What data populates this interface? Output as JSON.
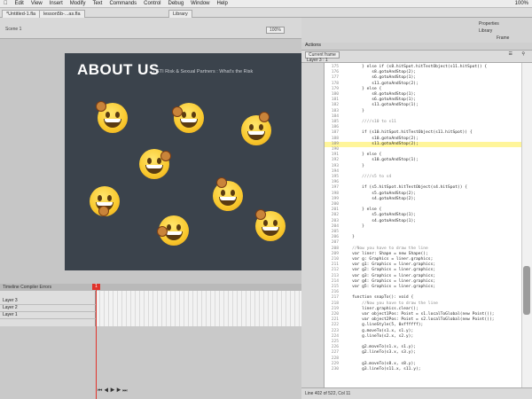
{
  "menubar": {
    "items": [
      "Edit",
      "View",
      "Insert",
      "Modify",
      "Text",
      "Commands",
      "Control",
      "Debug",
      "Window",
      "Help"
    ],
    "right": "100%"
  },
  "tabs": [
    "*Untitled-1.fla",
    "lesson5b-...as.fla",
    "Library"
  ],
  "stage": {
    "scene": "Scene 1",
    "zoom": "100%"
  },
  "canvas": {
    "title": "ABOUT US",
    "subtitle": "/ STI Risk & Sexual Partners : What's the Risk"
  },
  "timeline": {
    "header": "Timeline   Compiler Errors",
    "layers": [
      "Layer 3",
      "Layer 2",
      "Layer 1"
    ],
    "current_frame": "1"
  },
  "actions": {
    "title": "Actions",
    "tab": "Current frame",
    "layer": "Layer 3 : 1",
    "status": "Line 402 of 522, Col 11",
    "right_panel_labels": [
      "Properties",
      "Library",
      "Frame"
    ]
  },
  "code_lines": [
    {
      "n": "175",
      "t": "        } else if (s8.hitSpot.hitTestObject(s11.hitSpot)) {",
      "c": ""
    },
    {
      "n": "176",
      "t": "            s8.gotoAndStop(2);",
      "c": ""
    },
    {
      "n": "177",
      "t": "            s6.gotoAndStop(1);",
      "c": ""
    },
    {
      "n": "178",
      "t": "            s11.gotoAndStop(2);",
      "c": ""
    },
    {
      "n": "179",
      "t": "        } else {",
      "c": ""
    },
    {
      "n": "180",
      "t": "            s8.gotoAndStop(1);",
      "c": ""
    },
    {
      "n": "181",
      "t": "            s6.gotoAndStop(1);",
      "c": ""
    },
    {
      "n": "182",
      "t": "            s11.gotoAndStop(1);",
      "c": ""
    },
    {
      "n": "183",
      "t": "        }",
      "c": ""
    },
    {
      "n": "184",
      "t": "",
      "c": ""
    },
    {
      "n": "185",
      "t": "        ////s10 to s11",
      "c": "cm"
    },
    {
      "n": "186",
      "t": "",
      "c": ""
    },
    {
      "n": "187",
      "t": "        if (s10.hitSpot.hitTestObject(s11.hitSpot)) {",
      "c": ""
    },
    {
      "n": "188",
      "t": "            s10.gotoAndStop(2);",
      "c": ""
    },
    {
      "n": "189",
      "t": "            s11.gotoAndStop(2);",
      "c": "hl"
    },
    {
      "n": "190",
      "t": "",
      "c": ""
    },
    {
      "n": "191",
      "t": "        } else {",
      "c": ""
    },
    {
      "n": "192",
      "t": "            s10.gotoAndStop(1);",
      "c": ""
    },
    {
      "n": "193",
      "t": "        }",
      "c": ""
    },
    {
      "n": "194",
      "t": "",
      "c": ""
    },
    {
      "n": "195",
      "t": "        ////s5 to s4",
      "c": "cm"
    },
    {
      "n": "196",
      "t": "",
      "c": ""
    },
    {
      "n": "197",
      "t": "        if (s5.hitSpot.hitTestObject(s4.hitSpot)) {",
      "c": ""
    },
    {
      "n": "198",
      "t": "            s5.gotoAndStop(2);",
      "c": ""
    },
    {
      "n": "199",
      "t": "            s4.gotoAndStop(2);",
      "c": ""
    },
    {
      "n": "200",
      "t": "",
      "c": ""
    },
    {
      "n": "201",
      "t": "        } else {",
      "c": ""
    },
    {
      "n": "202",
      "t": "            s5.gotoAndStop(1);",
      "c": ""
    },
    {
      "n": "203",
      "t": "            s4.gotoAndStop(1);",
      "c": ""
    },
    {
      "n": "204",
      "t": "        }",
      "c": ""
    },
    {
      "n": "205",
      "t": "",
      "c": ""
    },
    {
      "n": "206",
      "t": "    }",
      "c": ""
    },
    {
      "n": "207",
      "t": "",
      "c": ""
    },
    {
      "n": "208",
      "t": "    //Now you have to draw the line",
      "c": "cm"
    },
    {
      "n": "209",
      "t": "    var liner: Shape = new Shape();",
      "c": ""
    },
    {
      "n": "210",
      "t": "    var g: Graphics = liner.graphics;",
      "c": ""
    },
    {
      "n": "211",
      "t": "    var g1: Graphics = liner.graphics;",
      "c": ""
    },
    {
      "n": "212",
      "t": "    var g2: Graphics = liner.graphics;",
      "c": ""
    },
    {
      "n": "213",
      "t": "    var g3: Graphics = liner.graphics;",
      "c": ""
    },
    {
      "n": "214",
      "t": "    var g4: Graphics = liner.graphics;",
      "c": ""
    },
    {
      "n": "215",
      "t": "    var g5: Graphics = liner.graphics;",
      "c": ""
    },
    {
      "n": "216",
      "t": "",
      "c": ""
    },
    {
      "n": "217",
      "t": "    function snapTo(): void {",
      "c": ""
    },
    {
      "n": "218",
      "t": "        //Now you have to draw the line",
      "c": "cm"
    },
    {
      "n": "219",
      "t": "        liner.graphics.clear();",
      "c": ""
    },
    {
      "n": "220",
      "t": "        var object1Pos: Point = s1.localToGlobal(new Point());",
      "c": ""
    },
    {
      "n": "221",
      "t": "        var object2Pos: Point = s2.localToGlobal(new Point());",
      "c": ""
    },
    {
      "n": "222",
      "t": "        g.lineStyle(5, 0xffffff);",
      "c": ""
    },
    {
      "n": "223",
      "t": "        g.moveTo(s1.x, s1.y);",
      "c": ""
    },
    {
      "n": "224",
      "t": "        g.lineTo(s2.x, s2.y);",
      "c": ""
    },
    {
      "n": "225",
      "t": "",
      "c": ""
    },
    {
      "n": "226",
      "t": "        g2.moveTo(s1.x, s1.y);",
      "c": ""
    },
    {
      "n": "227",
      "t": "        g2.lineTo(s3.x, s3.y);",
      "c": ""
    },
    {
      "n": "228",
      "t": "",
      "c": ""
    },
    {
      "n": "229",
      "t": "        g3.moveTo(s8.x, s8.y);",
      "c": ""
    },
    {
      "n": "230",
      "t": "        g3.lineTo(s11.x, s11.y);",
      "c": ""
    }
  ]
}
